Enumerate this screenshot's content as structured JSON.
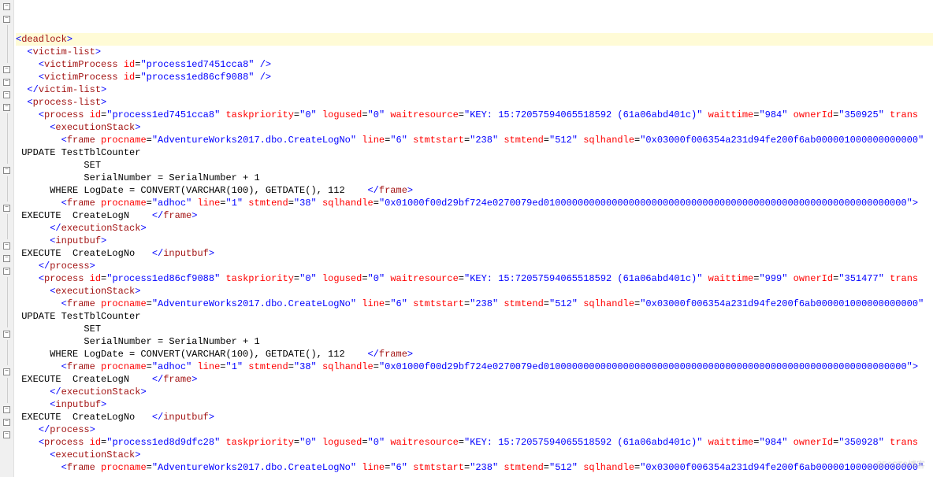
{
  "watermark": "@51CTO博客",
  "lines": [
    {
      "fold": "minus",
      "highlight": true,
      "indent": 0,
      "parts": [
        {
          "t": "lt"
        },
        {
          "t": "name",
          "v": "deadlock"
        },
        {
          "t": "gt"
        }
      ]
    },
    {
      "fold": "minus",
      "indent": 1,
      "parts": [
        {
          "t": "lt"
        },
        {
          "t": "name",
          "v": "victim-list"
        },
        {
          "t": "gt"
        }
      ]
    },
    {
      "fold": "none",
      "indent": 2,
      "parts": [
        {
          "t": "lt"
        },
        {
          "t": "name",
          "v": "victimProcess"
        },
        {
          "t": "sp"
        },
        {
          "t": "attr",
          "n": "id",
          "v": "process1ed7451cca8"
        },
        {
          "t": "sp"
        },
        {
          "t": "slashgt"
        }
      ]
    },
    {
      "fold": "none",
      "indent": 2,
      "parts": [
        {
          "t": "lt"
        },
        {
          "t": "name",
          "v": "victimProcess"
        },
        {
          "t": "sp"
        },
        {
          "t": "attr",
          "n": "id",
          "v": "process1ed86cf9088"
        },
        {
          "t": "sp"
        },
        {
          "t": "slashgt"
        }
      ]
    },
    {
      "fold": "none",
      "indent": 1,
      "parts": [
        {
          "t": "ltslash"
        },
        {
          "t": "name",
          "v": "victim-list"
        },
        {
          "t": "gt"
        }
      ]
    },
    {
      "fold": "minus",
      "indent": 1,
      "parts": [
        {
          "t": "lt"
        },
        {
          "t": "name",
          "v": "process-list"
        },
        {
          "t": "gt"
        }
      ]
    },
    {
      "fold": "minus",
      "indent": 2,
      "parts": [
        {
          "t": "lt"
        },
        {
          "t": "name",
          "v": "process"
        },
        {
          "t": "sp"
        },
        {
          "t": "attr",
          "n": "id",
          "v": "process1ed7451cca8"
        },
        {
          "t": "sp"
        },
        {
          "t": "attr",
          "n": "taskpriority",
          "v": "0"
        },
        {
          "t": "sp"
        },
        {
          "t": "attr",
          "n": "logused",
          "v": "0"
        },
        {
          "t": "sp"
        },
        {
          "t": "attr",
          "n": "waitresource",
          "v": "KEY: 15:72057594065518592 (61a06abd401c)"
        },
        {
          "t": "sp"
        },
        {
          "t": "attr",
          "n": "waittime",
          "v": "984"
        },
        {
          "t": "sp"
        },
        {
          "t": "attr",
          "n": "ownerId",
          "v": "350925"
        },
        {
          "t": "sp"
        },
        {
          "t": "attrname",
          "n": "trans"
        }
      ]
    },
    {
      "fold": "minus",
      "indent": 3,
      "parts": [
        {
          "t": "lt"
        },
        {
          "t": "name",
          "v": "executionStack"
        },
        {
          "t": "gt"
        }
      ]
    },
    {
      "fold": "minus",
      "indent": 4,
      "parts": [
        {
          "t": "lt"
        },
        {
          "t": "name",
          "v": "frame"
        },
        {
          "t": "sp"
        },
        {
          "t": "attr",
          "n": "procname",
          "v": "AdventureWorks2017.dbo.CreateLogNo"
        },
        {
          "t": "sp"
        },
        {
          "t": "attr",
          "n": "line",
          "v": "6"
        },
        {
          "t": "sp"
        },
        {
          "t": "attr",
          "n": "stmtstart",
          "v": "238"
        },
        {
          "t": "sp"
        },
        {
          "t": "attr",
          "n": "stmtend",
          "v": "512"
        },
        {
          "t": "sp"
        },
        {
          "t": "attr",
          "n": "sqlhandle",
          "v": "0x03000f006354a231d94fe200f6ab000001000000000000"
        }
      ]
    },
    {
      "fold": "none",
      "indent": 0,
      "parts": [
        {
          "t": "text",
          "v": " UPDATE TestTblCounter"
        }
      ]
    },
    {
      "fold": "none",
      "indent": 0,
      "parts": [
        {
          "t": "text",
          "v": "            SET"
        }
      ]
    },
    {
      "fold": "none",
      "indent": 0,
      "parts": [
        {
          "t": "text",
          "v": "            SerialNumber = SerialNumber + 1"
        }
      ]
    },
    {
      "fold": "none",
      "indent": 0,
      "parts": [
        {
          "t": "text",
          "v": "      WHERE LogDate = CONVERT(VARCHAR(100), GETDATE(), 112    "
        },
        {
          "t": "ltslash"
        },
        {
          "t": "name",
          "v": "frame"
        },
        {
          "t": "gt"
        }
      ]
    },
    {
      "fold": "minus",
      "indent": 4,
      "parts": [
        {
          "t": "lt"
        },
        {
          "t": "name",
          "v": "frame"
        },
        {
          "t": "sp"
        },
        {
          "t": "attr",
          "n": "procname",
          "v": "adhoc"
        },
        {
          "t": "sp"
        },
        {
          "t": "attr",
          "n": "line",
          "v": "1"
        },
        {
          "t": "sp"
        },
        {
          "t": "attr",
          "n": "stmtend",
          "v": "38"
        },
        {
          "t": "sp"
        },
        {
          "t": "attr",
          "n": "sqlhandle",
          "v": "0x01000f00d29bf724e0270079ed0100000000000000000000000000000000000000000000000000000000000000"
        },
        {
          "t": "gt"
        }
      ]
    },
    {
      "fold": "none",
      "indent": 0,
      "parts": [
        {
          "t": "text",
          "v": " EXECUTE  CreateLogN    "
        },
        {
          "t": "ltslash"
        },
        {
          "t": "name",
          "v": "frame"
        },
        {
          "t": "gt"
        }
      ]
    },
    {
      "fold": "none",
      "indent": 3,
      "parts": [
        {
          "t": "ltslash"
        },
        {
          "t": "name",
          "v": "executionStack"
        },
        {
          "t": "gt"
        }
      ]
    },
    {
      "fold": "minus",
      "indent": 3,
      "parts": [
        {
          "t": "lt"
        },
        {
          "t": "name",
          "v": "inputbuf"
        },
        {
          "t": "gt"
        }
      ]
    },
    {
      "fold": "none",
      "indent": 0,
      "parts": [
        {
          "t": "text",
          "v": " EXECUTE  CreateLogNo   "
        },
        {
          "t": "ltslash"
        },
        {
          "t": "name",
          "v": "inputbuf"
        },
        {
          "t": "gt"
        }
      ]
    },
    {
      "fold": "none",
      "indent": 2,
      "parts": [
        {
          "t": "ltslash"
        },
        {
          "t": "name",
          "v": "process"
        },
        {
          "t": "gt"
        }
      ]
    },
    {
      "fold": "minus",
      "indent": 2,
      "parts": [
        {
          "t": "lt"
        },
        {
          "t": "name",
          "v": "process"
        },
        {
          "t": "sp"
        },
        {
          "t": "attr",
          "n": "id",
          "v": "process1ed86cf9088"
        },
        {
          "t": "sp"
        },
        {
          "t": "attr",
          "n": "taskpriority",
          "v": "0"
        },
        {
          "t": "sp"
        },
        {
          "t": "attr",
          "n": "logused",
          "v": "0"
        },
        {
          "t": "sp"
        },
        {
          "t": "attr",
          "n": "waitresource",
          "v": "KEY: 15:72057594065518592 (61a06abd401c)"
        },
        {
          "t": "sp"
        },
        {
          "t": "attr",
          "n": "waittime",
          "v": "999"
        },
        {
          "t": "sp"
        },
        {
          "t": "attr",
          "n": "ownerId",
          "v": "351477"
        },
        {
          "t": "sp"
        },
        {
          "t": "attrname",
          "n": "trans"
        }
      ]
    },
    {
      "fold": "minus",
      "indent": 3,
      "parts": [
        {
          "t": "lt"
        },
        {
          "t": "name",
          "v": "executionStack"
        },
        {
          "t": "gt"
        }
      ]
    },
    {
      "fold": "minus",
      "indent": 4,
      "parts": [
        {
          "t": "lt"
        },
        {
          "t": "name",
          "v": "frame"
        },
        {
          "t": "sp"
        },
        {
          "t": "attr",
          "n": "procname",
          "v": "AdventureWorks2017.dbo.CreateLogNo"
        },
        {
          "t": "sp"
        },
        {
          "t": "attr",
          "n": "line",
          "v": "6"
        },
        {
          "t": "sp"
        },
        {
          "t": "attr",
          "n": "stmtstart",
          "v": "238"
        },
        {
          "t": "sp"
        },
        {
          "t": "attr",
          "n": "stmtend",
          "v": "512"
        },
        {
          "t": "sp"
        },
        {
          "t": "attr",
          "n": "sqlhandle",
          "v": "0x03000f006354a231d94fe200f6ab000001000000000000"
        }
      ]
    },
    {
      "fold": "none",
      "indent": 0,
      "parts": [
        {
          "t": "text",
          "v": " UPDATE TestTblCounter"
        }
      ]
    },
    {
      "fold": "none",
      "indent": 0,
      "parts": [
        {
          "t": "text",
          "v": "            SET"
        }
      ]
    },
    {
      "fold": "none",
      "indent": 0,
      "parts": [
        {
          "t": "text",
          "v": "            SerialNumber = SerialNumber + 1"
        }
      ]
    },
    {
      "fold": "none",
      "indent": 0,
      "parts": [
        {
          "t": "text",
          "v": "      WHERE LogDate = CONVERT(VARCHAR(100), GETDATE(), 112    "
        },
        {
          "t": "ltslash"
        },
        {
          "t": "name",
          "v": "frame"
        },
        {
          "t": "gt"
        }
      ]
    },
    {
      "fold": "minus",
      "indent": 4,
      "parts": [
        {
          "t": "lt"
        },
        {
          "t": "name",
          "v": "frame"
        },
        {
          "t": "sp"
        },
        {
          "t": "attr",
          "n": "procname",
          "v": "adhoc"
        },
        {
          "t": "sp"
        },
        {
          "t": "attr",
          "n": "line",
          "v": "1"
        },
        {
          "t": "sp"
        },
        {
          "t": "attr",
          "n": "stmtend",
          "v": "38"
        },
        {
          "t": "sp"
        },
        {
          "t": "attr",
          "n": "sqlhandle",
          "v": "0x01000f00d29bf724e0270079ed0100000000000000000000000000000000000000000000000000000000000000"
        },
        {
          "t": "gt"
        }
      ]
    },
    {
      "fold": "none",
      "indent": 0,
      "parts": [
        {
          "t": "text",
          "v": " EXECUTE  CreateLogN    "
        },
        {
          "t": "ltslash"
        },
        {
          "t": "name",
          "v": "frame"
        },
        {
          "t": "gt"
        }
      ]
    },
    {
      "fold": "none",
      "indent": 3,
      "parts": [
        {
          "t": "ltslash"
        },
        {
          "t": "name",
          "v": "executionStack"
        },
        {
          "t": "gt"
        }
      ]
    },
    {
      "fold": "minus",
      "indent": 3,
      "parts": [
        {
          "t": "lt"
        },
        {
          "t": "name",
          "v": "inputbuf"
        },
        {
          "t": "gt"
        }
      ]
    },
    {
      "fold": "none",
      "indent": 0,
      "parts": [
        {
          "t": "text",
          "v": " EXECUTE  CreateLogNo   "
        },
        {
          "t": "ltslash"
        },
        {
          "t": "name",
          "v": "inputbuf"
        },
        {
          "t": "gt"
        }
      ]
    },
    {
      "fold": "none",
      "indent": 2,
      "parts": [
        {
          "t": "ltslash"
        },
        {
          "t": "name",
          "v": "process"
        },
        {
          "t": "gt"
        }
      ]
    },
    {
      "fold": "minus",
      "indent": 2,
      "parts": [
        {
          "t": "lt"
        },
        {
          "t": "name",
          "v": "process"
        },
        {
          "t": "sp"
        },
        {
          "t": "attr",
          "n": "id",
          "v": "process1ed8d9dfc28"
        },
        {
          "t": "sp"
        },
        {
          "t": "attr",
          "n": "taskpriority",
          "v": "0"
        },
        {
          "t": "sp"
        },
        {
          "t": "attr",
          "n": "logused",
          "v": "0"
        },
        {
          "t": "sp"
        },
        {
          "t": "attr",
          "n": "waitresource",
          "v": "KEY: 15:72057594065518592 (61a06abd401c)"
        },
        {
          "t": "sp"
        },
        {
          "t": "attr",
          "n": "waittime",
          "v": "984"
        },
        {
          "t": "sp"
        },
        {
          "t": "attr",
          "n": "ownerId",
          "v": "350928"
        },
        {
          "t": "sp"
        },
        {
          "t": "attrname",
          "n": "trans"
        }
      ]
    },
    {
      "fold": "minus",
      "indent": 3,
      "parts": [
        {
          "t": "lt"
        },
        {
          "t": "name",
          "v": "executionStack"
        },
        {
          "t": "gt"
        }
      ]
    },
    {
      "fold": "minus",
      "indent": 4,
      "parts": [
        {
          "t": "lt"
        },
        {
          "t": "name",
          "v": "frame"
        },
        {
          "t": "sp"
        },
        {
          "t": "attr",
          "n": "procname",
          "v": "AdventureWorks2017.dbo.CreateLogNo"
        },
        {
          "t": "sp"
        },
        {
          "t": "attr",
          "n": "line",
          "v": "6"
        },
        {
          "t": "sp"
        },
        {
          "t": "attr",
          "n": "stmtstart",
          "v": "238"
        },
        {
          "t": "sp"
        },
        {
          "t": "attr",
          "n": "stmtend",
          "v": "512"
        },
        {
          "t": "sp"
        },
        {
          "t": "attr",
          "n": "sqlhandle",
          "v": "0x03000f006354a231d94fe200f6ab000001000000000000"
        }
      ]
    }
  ]
}
